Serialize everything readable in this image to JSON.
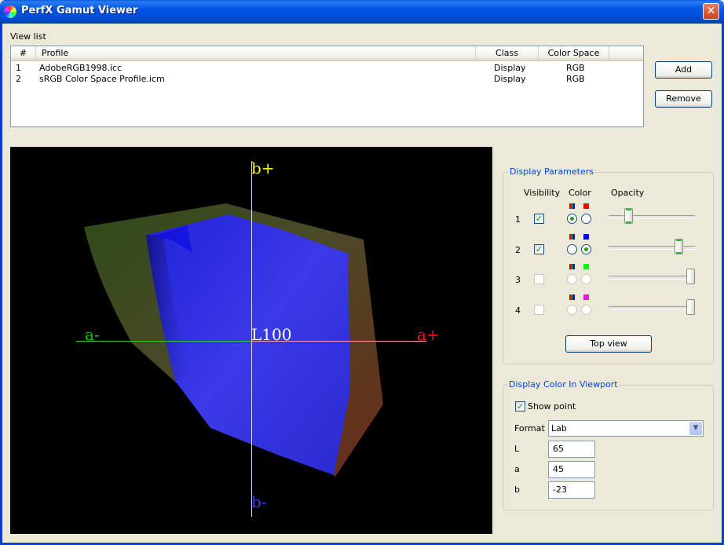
{
  "window": {
    "title": "PerfX Gamut Viewer",
    "close_glyph": "✕"
  },
  "view_list": {
    "label": "View list",
    "columns": [
      "#",
      "Profile",
      "Class",
      "Color Space"
    ],
    "rows": [
      {
        "num": "1",
        "profile": "AdobeRGB1998.icc",
        "class": "Display",
        "color_space": "RGB"
      },
      {
        "num": "2",
        "profile": "sRGB Color Space Profile.icm",
        "class": "Display",
        "color_space": "RGB"
      }
    ]
  },
  "buttons": {
    "add": "Add",
    "remove": "Remove",
    "top_view": "Top view"
  },
  "viewport": {
    "axis_labels": {
      "b_plus": "b+",
      "b_minus": "b-",
      "a_minus": "a-",
      "a_plus": "a+",
      "center": "L100"
    },
    "axis_colors": {
      "b_plus": "#ffff00",
      "b_minus": "#3a3aff",
      "a_minus": "#00cc00",
      "a_plus": "#ff1010"
    },
    "gamut_colors": {
      "outer": "#5e4a26",
      "inner": "#2a2ae0"
    }
  },
  "display_parameters": {
    "title": "Display Parameters",
    "headers": {
      "visibility": "Visibility",
      "color": "Color",
      "opacity": "Opacity"
    },
    "rows": [
      {
        "num": "1",
        "visible": true,
        "enabled": true,
        "color_mode": "profile",
        "solid_color": "#ff0000",
        "opacity": 0.2
      },
      {
        "num": "2",
        "visible": true,
        "enabled": true,
        "color_mode": "solid",
        "solid_color": "#0000ff",
        "opacity": 0.85
      },
      {
        "num": "3",
        "visible": false,
        "enabled": false,
        "color_mode": "none",
        "solid_color": "#00ff00",
        "opacity": 1.0
      },
      {
        "num": "4",
        "visible": false,
        "enabled": false,
        "color_mode": "none",
        "solid_color": "#ff00ff",
        "opacity": 1.0
      }
    ]
  },
  "display_color": {
    "title": "Display Color In Viewport",
    "show_point_label": "Show point",
    "show_point": true,
    "format_label": "Format",
    "format_value": "Lab",
    "fields": [
      {
        "label": "L",
        "value": "65"
      },
      {
        "label": "a",
        "value": "45"
      },
      {
        "label": "b",
        "value": "-23"
      }
    ]
  }
}
